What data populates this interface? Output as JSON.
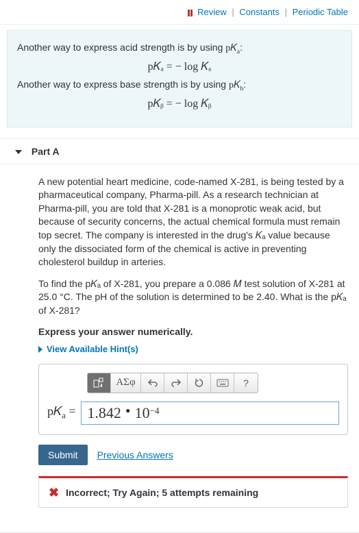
{
  "topLinks": {
    "review": "Review",
    "constants": "Constants",
    "periodic": "Periodic Table"
  },
  "intro": {
    "line1_a": "Another way to express acid strength is by using ",
    "line1_b": ":",
    "eq1": "p𝐾ₐ = − log 𝐾ₐ",
    "line2_a": "Another way to express base strength is by using ",
    "line2_b": ":",
    "eq2": "p𝐾ᵦ = − log 𝐾ᵦ",
    "pKa_sym": "p𝐾",
    "pKb_sym": "p𝐾"
  },
  "part": {
    "label": "Part A",
    "para1": "A new potential heart medicine, code-named X-281, is being tested by a pharmaceutical company, Pharma-pill. As a research technician at Pharma-pill, you are told that X-281 is a monoprotic weak acid, but because of security concerns, the actual chemical formula must remain top secret. The company is interested in the drug's 𝐾ₐ value because only the dissociated form of the chemical is active in preventing cholesterol buildup in arteries.",
    "para2": "To find the p𝐾ₐ of X-281, you prepare a 0.086 𝑀 test solution of X-281 at 25.0 °C. The pH of the solution is determined to be 2.40. What is the p𝐾ₐ of X-281?",
    "instr": "Express your answer numerically.",
    "hints": "View Available Hint(s)"
  },
  "toolbar": {
    "greek": "ΑΣφ",
    "help": "?"
  },
  "answer": {
    "label_pre": "p𝐾",
    "label_sub": "a",
    "label_post": " = ",
    "value_mantissa": "1.842",
    "value_base": "10",
    "value_exp": "−4"
  },
  "actions": {
    "submit": "Submit",
    "previous": "Previous Answers"
  },
  "feedback": {
    "text": "Incorrect; Try Again; 5 attempts remaining"
  }
}
